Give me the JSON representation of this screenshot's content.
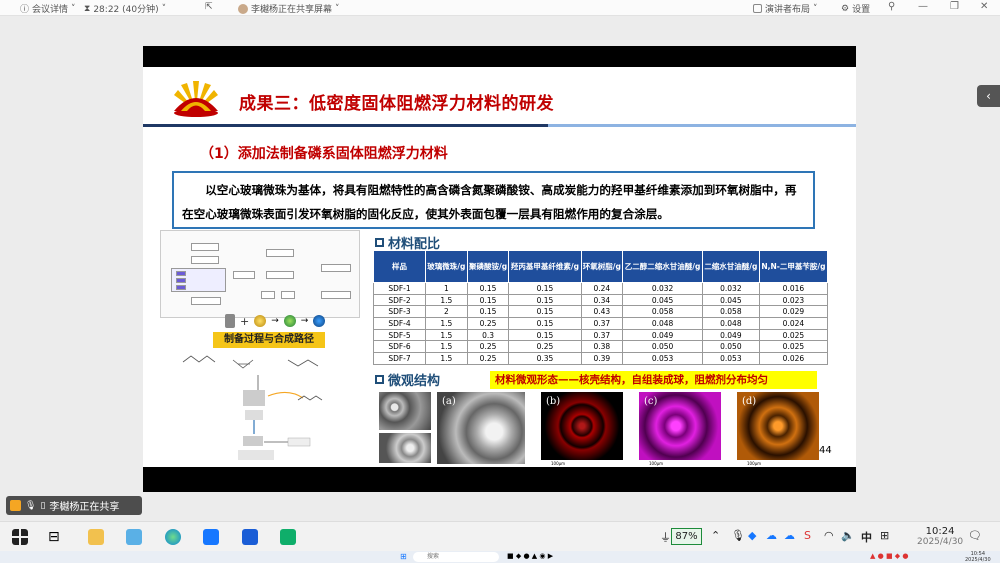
{
  "meeting_bar": {
    "details_label": "会议详情",
    "timer": "28:22 (40分钟)",
    "sharing_text": "李樾杨正在共享屏幕",
    "layout_label": "演讲者布局",
    "settings_label": "设置"
  },
  "slide": {
    "title": "成果三：低密度固体阻燃浮力材料的研发",
    "subtitle": "（1）添加法制备磷系固体阻燃浮力材料",
    "intro": "以空心玻璃微珠为基体，将具有阻燃特性的高含磷含氮聚磷酸铵、高成炭能力的羟甲基纤维素添加到环氧树脂中，再在空心玻璃微珠表面引发环氧树脂的固化反应，使其外表面包覆一层具有阻燃作用的复合涂层。",
    "synthesis_banner": "制备过程与合成路径",
    "materials_heading": "材料配比",
    "micro_heading": "微观结构",
    "micro_note": "材料微观形态——核壳结构，自组装成球，阻燃剂分布均匀",
    "page_number": "44",
    "table": {
      "headers": [
        "样品",
        "玻璃微珠/g",
        "聚磷酸铵/g",
        "羟丙基甲基纤维素/g",
        "环氧树脂/g",
        "乙二醇二缩水甘油醚/g",
        "二缩水甘油醚/g",
        "N,N-二甲基苄胺/g"
      ],
      "rows": [
        [
          "SDF-1",
          "1",
          "0.15",
          "0.15",
          "0.24",
          "0.032",
          "0.032",
          "0.016"
        ],
        [
          "SDF-2",
          "1.5",
          "0.15",
          "0.15",
          "0.34",
          "0.045",
          "0.045",
          "0.023"
        ],
        [
          "SDF-3",
          "2",
          "0.15",
          "0.15",
          "0.43",
          "0.058",
          "0.058",
          "0.029"
        ],
        [
          "SDF-4",
          "1.5",
          "0.25",
          "0.15",
          "0.37",
          "0.048",
          "0.048",
          "0.024"
        ],
        [
          "SDF-5",
          "1.5",
          "0.3",
          "0.15",
          "0.37",
          "0.049",
          "0.049",
          "0.025"
        ],
        [
          "SDF-6",
          "1.5",
          "0.25",
          "0.25",
          "0.38",
          "0.050",
          "0.050",
          "0.025"
        ],
        [
          "SDF-7",
          "1.5",
          "0.25",
          "0.35",
          "0.39",
          "0.053",
          "0.053",
          "0.026"
        ]
      ]
    },
    "micro_labels": [
      "(a)",
      "(b)",
      "(c)",
      "(d)"
    ],
    "scale_labels": [
      "100μm",
      "100μm",
      "100μm"
    ]
  },
  "share_badge": {
    "text": "李樾杨正在共享"
  },
  "taskbar": {
    "battery": "87%",
    "ime": "中",
    "time": "10:24",
    "date": "2025/4/30",
    "remote_search": "搜索",
    "remote_time": "10:54",
    "remote_date": "2025/4/30"
  }
}
